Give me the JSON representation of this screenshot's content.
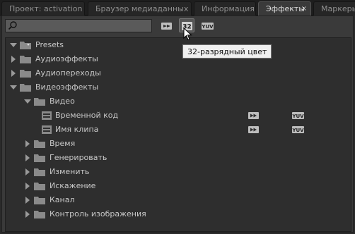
{
  "tabs": [
    {
      "label": "Проект: activation",
      "active": false
    },
    {
      "label": "Браузер медиаданных",
      "active": false
    },
    {
      "label": "Информация",
      "active": false
    },
    {
      "label": "Эффекты",
      "active": true,
      "close": "×"
    },
    {
      "label": "Маркеры",
      "active": false
    }
  ],
  "toolbar": {
    "search_value": "",
    "tooltip": "32-разрядный цвет",
    "badge_32": "32",
    "badge_yuv": "YUV"
  },
  "tree": [
    {
      "label": "Presets",
      "level": 0,
      "expanded": true,
      "kind": "presets"
    },
    {
      "label": "Аудиоэффекты",
      "level": 0,
      "expanded": false,
      "kind": "folder"
    },
    {
      "label": "Аудиопереходы",
      "level": 0,
      "expanded": false,
      "kind": "folder"
    },
    {
      "label": "Видеоэффекты",
      "level": 0,
      "expanded": true,
      "kind": "folder"
    },
    {
      "label": "Видео",
      "level": 1,
      "expanded": true,
      "kind": "folder"
    },
    {
      "label": "Временной код",
      "level": 2,
      "kind": "effect",
      "accelerated": true,
      "yuv": true
    },
    {
      "label": "Имя клипа",
      "level": 2,
      "kind": "effect",
      "accelerated": true,
      "yuv": true
    },
    {
      "label": "Время",
      "level": 1,
      "expanded": false,
      "kind": "folder"
    },
    {
      "label": "Генерировать",
      "level": 1,
      "expanded": false,
      "kind": "folder"
    },
    {
      "label": "Изменить",
      "level": 1,
      "expanded": false,
      "kind": "folder"
    },
    {
      "label": "Искажение",
      "level": 1,
      "expanded": false,
      "kind": "folder"
    },
    {
      "label": "Канал",
      "level": 1,
      "expanded": false,
      "kind": "folder"
    },
    {
      "label": "Контроль изображения",
      "level": 1,
      "expanded": false,
      "kind": "folder"
    }
  ],
  "colors": {
    "tab_active": "#3a3a3a",
    "tree_bg": "#2e2e2e",
    "folder": "#8a8a8a"
  }
}
